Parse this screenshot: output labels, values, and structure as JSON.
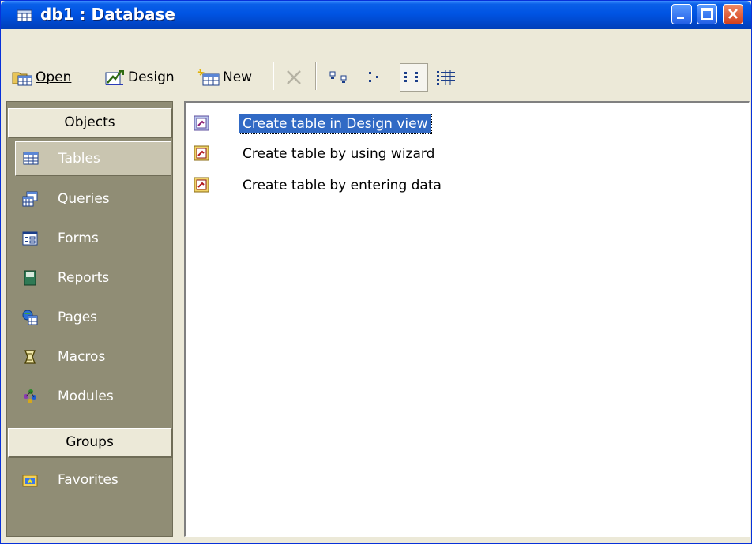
{
  "window": {
    "title": "db1 : Database"
  },
  "toolbar": {
    "open_label": "Open",
    "design_label": "Design",
    "new_label": "New",
    "icons": [
      "delete-icon",
      "large-icons-icon",
      "small-icons-icon",
      "list-view-icon",
      "details-view-icon"
    ]
  },
  "sidebar": {
    "objects_header": "Objects",
    "items": [
      {
        "label": "Tables",
        "icon": "table-icon"
      },
      {
        "label": "Queries",
        "icon": "query-icon"
      },
      {
        "label": "Forms",
        "icon": "form-icon"
      },
      {
        "label": "Reports",
        "icon": "report-icon"
      },
      {
        "label": "Pages",
        "icon": "page-icon"
      },
      {
        "label": "Macros",
        "icon": "macro-icon"
      },
      {
        "label": "Modules",
        "icon": "module-icon"
      }
    ],
    "selected": "Tables",
    "groups_header": "Groups",
    "groups": [
      {
        "label": "Favorites",
        "icon": "favorites-folder-icon"
      }
    ]
  },
  "list": {
    "items": [
      {
        "label": "Create table in Design view",
        "selected": true
      },
      {
        "label": "Create table by using wizard",
        "selected": false
      },
      {
        "label": "Create table by entering data",
        "selected": false
      }
    ]
  },
  "colors": {
    "titlebar": "#0054e3",
    "sidebar_bg": "#908d75",
    "selection": "#316ac5",
    "face": "#ece9d8"
  }
}
